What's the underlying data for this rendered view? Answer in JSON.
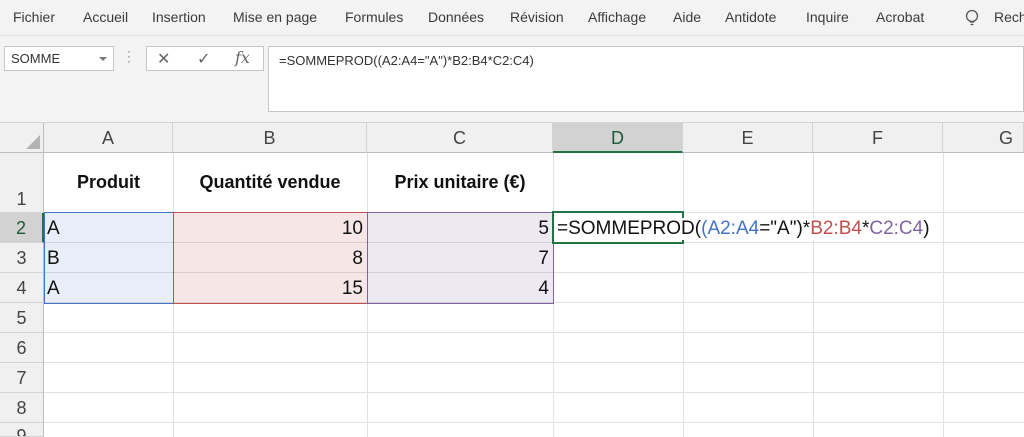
{
  "ribbon": {
    "tabs": [
      "Fichier",
      "Accueil",
      "Insertion",
      "Mise en page",
      "Formules",
      "Données",
      "Révision",
      "Affichage",
      "Aide",
      "Antidote",
      "Inquire",
      "Acrobat"
    ],
    "search_label": "Rech"
  },
  "formula_bar": {
    "name_box": "SOMME",
    "dots": "⋮",
    "cancel": "✕",
    "enter": "✓",
    "fx": "fx",
    "formula": "=SOMMEPROD((A2:A4=\"A\")*B2:B4*C2:C4)"
  },
  "sheet": {
    "columns": [
      "A",
      "B",
      "C",
      "D",
      "E",
      "F",
      "G"
    ],
    "rows": [
      "1",
      "2",
      "3",
      "4",
      "5",
      "6",
      "7",
      "8",
      "9"
    ],
    "headers": {
      "a1": "Produit",
      "b1": "Quantité vendue",
      "c1": "Prix unitaire (€)"
    },
    "data": [
      {
        "produit": "A",
        "quantite": "10",
        "prix": "5"
      },
      {
        "produit": "B",
        "quantite": "8",
        "prix": "7"
      },
      {
        "produit": "A",
        "quantite": "15",
        "prix": "4"
      }
    ],
    "edit_cell": {
      "part1": "=SOMMEPROD(",
      "part2": "(",
      "ref_a": "A2:A4",
      "part3": "=\"A\")*",
      "ref_b": "B2:B4",
      "part4": "*",
      "ref_c": "C2:C4",
      "part5": ")"
    }
  },
  "colors": {
    "ref_blue": "#4472c4",
    "ref_red": "#c0504d",
    "ref_purple": "#8064a2",
    "active_green": "#217346"
  }
}
